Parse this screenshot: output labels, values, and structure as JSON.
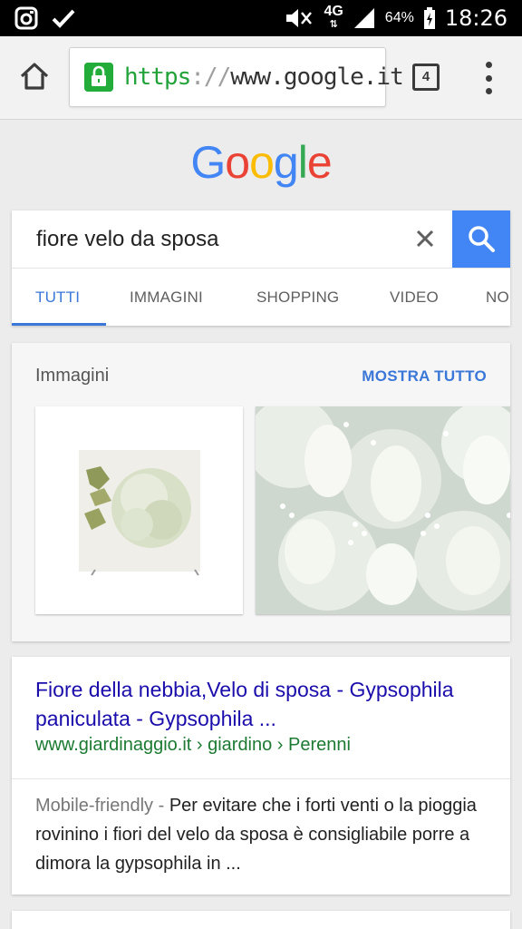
{
  "status_bar": {
    "left_icons": [
      "instagram-icon",
      "check-icon"
    ],
    "network": "4G",
    "battery": "64%",
    "time": "18:26"
  },
  "browser": {
    "url_scheme": "https",
    "url_separator": "://",
    "url_host": "www.google.it",
    "tab_count": "4"
  },
  "logo": {
    "letters": [
      "G",
      "o",
      "o",
      "g",
      "l",
      "e"
    ],
    "colors": [
      "#4285f4",
      "#ea4335",
      "#fbbc05",
      "#4285f4",
      "#34a853",
      "#ea4335"
    ]
  },
  "search": {
    "query": "fiore velo da sposa",
    "tabs": [
      {
        "label": "TUTTI",
        "active": true
      },
      {
        "label": "IMMAGINI"
      },
      {
        "label": "SHOPPING"
      },
      {
        "label": "VIDEO"
      },
      {
        "label": "NO"
      }
    ]
  },
  "images": {
    "title": "Immagini",
    "show_all": "MOSTRA TUTTO"
  },
  "result": {
    "title": "Fiore della nebbia,Velo di sposa - Gypsophila paniculata - Gypsophila ...",
    "url": "www.giardinaggio.it › giardino › Perenni",
    "mobile_tag": "Mobile-friendly",
    "tag_separator": " - ",
    "snippet": "Per evitare che i forti venti o la pioggia rovinino i fiori del velo da sposa è consigliabile porre a dimora la gypsophila in ..."
  },
  "colors": {
    "accent": "#3a77d8",
    "search_button": "#4285f4",
    "link": "#1a0dab",
    "url_green": "#1c7a32",
    "lock_green": "#22ac3a"
  }
}
